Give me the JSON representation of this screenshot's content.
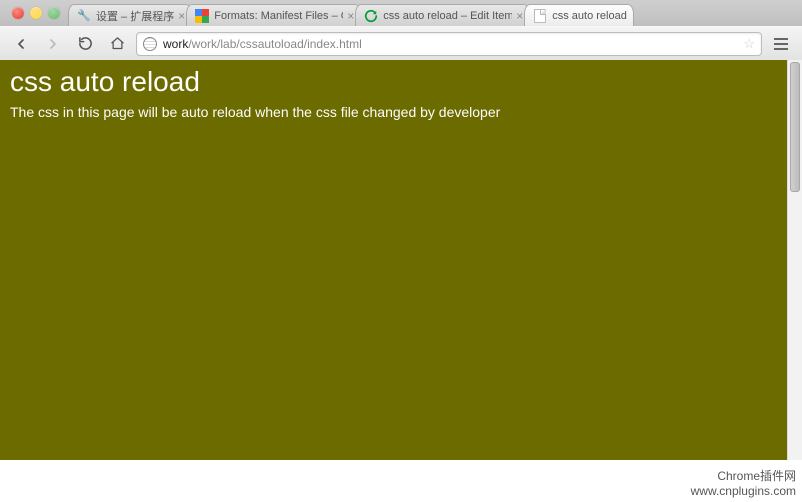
{
  "window": {
    "traffic_lights": [
      "close",
      "minimize",
      "maximize"
    ]
  },
  "tabs": [
    {
      "title": "设置 – 扩展程序",
      "icon": "wrench",
      "active": false
    },
    {
      "title": "Formats: Manifest Files – Go…",
      "icon": "google",
      "active": false
    },
    {
      "title": "css auto reload – Edit Item",
      "icon": "reload",
      "active": false
    },
    {
      "title": "css auto reload",
      "icon": "page",
      "active": true
    }
  ],
  "toolbar": {
    "back_enabled": true,
    "forward_enabled": false,
    "url_host": "work",
    "url_path": "/work/lab/cssautoload/index.html"
  },
  "page": {
    "heading": "css auto reload",
    "body": "The css in this page will be auto reload when the css file changed by developer"
  },
  "watermark": {
    "line1": "Chrome插件网",
    "line2": "www.cnplugins.com"
  }
}
